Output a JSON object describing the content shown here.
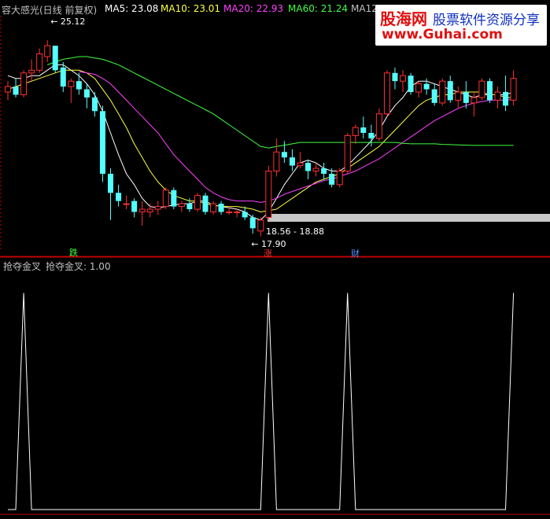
{
  "header": {
    "indicator_name": "容大感光(日线 前复权)",
    "ma5": "MA5: 23.08",
    "ma10": "MA10: 23.01",
    "ma20": "MA20: 22.93",
    "ma60": "MA60: 21.24",
    "ma120": "MA12"
  },
  "lower_panel": {
    "title": "抢夺金叉",
    "value": "抢夺金叉: 1.00"
  },
  "watermark": {
    "brand": "股海网",
    "slogan": "股票软件资源分享",
    "url": "www.Guhai.com"
  },
  "colors": {
    "up": "#ff3030",
    "down": "#54ffff",
    "ma5": "#ffffff",
    "ma10": "#ffff40",
    "ma20": "#ff40ff",
    "ma60": "#40ff40",
    "ma120": "#c0c0c0",
    "grid": "#8b0000"
  },
  "chart_data": [
    {
      "type": "candlestick",
      "annotations": {
        "high_label": "25.12",
        "low_label": "17.90",
        "range_label": "18.56 - 18.88",
        "marker_down": "跌",
        "marker_up": "涨",
        "marker_wealth": "财"
      },
      "ylim": [
        17.4,
        26.0
      ],
      "candles": [
        [
          23.2,
          23.6,
          22.9,
          23.4
        ],
        [
          23.4,
          23.7,
          23.0,
          23.1
        ],
        [
          23.1,
          24.0,
          23.0,
          23.9
        ],
        [
          23.9,
          24.4,
          23.6,
          24.0
        ],
        [
          24.0,
          24.8,
          23.9,
          24.6
        ],
        [
          24.5,
          25.1,
          24.3,
          24.9
        ],
        [
          24.9,
          24.9,
          23.9,
          24.0
        ],
        [
          24.1,
          24.3,
          23.2,
          23.4
        ],
        [
          23.4,
          23.7,
          22.8,
          23.6
        ],
        [
          23.6,
          23.9,
          23.1,
          23.3
        ],
        [
          23.3,
          23.5,
          22.6,
          23.0
        ],
        [
          23.0,
          23.2,
          22.3,
          22.5
        ],
        [
          22.5,
          22.7,
          19.9,
          20.2
        ],
        [
          20.2,
          20.4,
          18.5,
          19.5
        ],
        [
          19.5,
          19.8,
          19.0,
          19.2
        ],
        [
          19.1,
          19.4,
          18.9,
          19.1
        ],
        [
          19.2,
          19.3,
          18.6,
          18.8
        ],
        [
          18.8,
          19.2,
          18.3,
          18.9
        ],
        [
          18.8,
          19.1,
          18.6,
          18.9
        ],
        [
          18.9,
          19.2,
          18.7,
          19.0
        ],
        [
          19.0,
          19.7,
          18.9,
          19.6
        ],
        [
          19.6,
          19.7,
          18.9,
          19.0
        ],
        [
          19.0,
          19.2,
          18.8,
          19.1
        ],
        [
          19.1,
          19.3,
          18.8,
          18.9
        ],
        [
          18.9,
          19.5,
          18.8,
          19.4
        ],
        [
          19.4,
          19.5,
          18.7,
          18.8
        ],
        [
          18.8,
          19.2,
          18.7,
          19.1
        ],
        [
          19.1,
          19.2,
          18.7,
          18.8
        ],
        [
          18.8,
          19.0,
          18.7,
          18.8
        ],
        [
          18.8,
          18.9,
          18.6,
          18.8
        ],
        [
          18.8,
          19.0,
          18.5,
          18.6
        ],
        [
          18.6,
          18.7,
          18.0,
          18.2
        ],
        [
          18.1,
          18.6,
          17.9,
          18.5
        ],
        [
          18.6,
          20.5,
          18.5,
          20.3
        ],
        [
          20.3,
          21.5,
          20.1,
          21.0
        ],
        [
          21.0,
          21.4,
          20.6,
          20.8
        ],
        [
          20.8,
          21.1,
          20.3,
          20.5
        ],
        [
          20.5,
          21.0,
          20.4,
          20.6
        ],
        [
          20.6,
          20.7,
          20.0,
          20.3
        ],
        [
          20.3,
          20.6,
          20.1,
          20.4
        ],
        [
          20.4,
          20.6,
          20.0,
          20.2
        ],
        [
          20.2,
          20.4,
          19.7,
          19.8
        ],
        [
          19.8,
          20.4,
          19.7,
          20.3
        ],
        [
          20.3,
          21.7,
          20.2,
          21.6
        ],
        [
          21.6,
          22.0,
          21.3,
          21.9
        ],
        [
          21.9,
          22.3,
          21.5,
          21.7
        ],
        [
          21.7,
          22.0,
          21.2,
          21.5
        ],
        [
          21.5,
          22.6,
          21.4,
          22.4
        ],
        [
          22.4,
          24.0,
          22.3,
          23.9
        ],
        [
          23.9,
          24.1,
          23.3,
          23.6
        ],
        [
          23.6,
          24.0,
          23.2,
          23.8
        ],
        [
          23.8,
          23.9,
          23.1,
          23.2
        ],
        [
          23.2,
          23.6,
          23.0,
          23.5
        ],
        [
          23.5,
          23.7,
          23.1,
          23.3
        ],
        [
          23.3,
          23.5,
          22.7,
          22.8
        ],
        [
          22.8,
          23.7,
          22.7,
          23.6
        ],
        [
          23.6,
          23.8,
          22.8,
          22.9
        ],
        [
          22.9,
          23.4,
          22.6,
          23.2
        ],
        [
          23.2,
          23.6,
          22.6,
          22.8
        ],
        [
          22.8,
          23.2,
          22.3,
          23.0
        ],
        [
          23.0,
          23.7,
          22.9,
          23.6
        ],
        [
          23.6,
          23.7,
          22.8,
          22.9
        ],
        [
          22.9,
          23.4,
          22.6,
          23.2
        ],
        [
          23.2,
          23.8,
          22.5,
          22.7
        ],
        [
          22.9,
          24.0,
          22.7,
          23.7
        ]
      ],
      "ma_series": [
        {
          "name": "MA5",
          "values": [
            23.8,
            23.7,
            23.7,
            23.8,
            23.8,
            24.0,
            24.2,
            24.2,
            24.0,
            23.8,
            23.5,
            23.1,
            22.5,
            21.7,
            20.9,
            20.2,
            19.8,
            19.3,
            19.0,
            18.95,
            19.0,
            19.05,
            19.1,
            19.1,
            19.2,
            19.2,
            19.05,
            19.0,
            18.95,
            18.9,
            18.8,
            18.6,
            18.5,
            18.8,
            19.3,
            19.8,
            20.2,
            20.6,
            20.7,
            20.6,
            20.4,
            20.3,
            20.3,
            20.5,
            20.8,
            21.1,
            21.4,
            21.8,
            22.3,
            22.7,
            23.0,
            23.4,
            23.6,
            23.6,
            23.5,
            23.4,
            23.3,
            23.2,
            23.1,
            23.0,
            23.1,
            23.1,
            23.1,
            23.1,
            23.2
          ]
        },
        {
          "name": "MA10",
          "values": [
            23.3,
            23.4,
            23.5,
            23.6,
            23.7,
            23.8,
            23.9,
            24.0,
            24.0,
            24.0,
            23.9,
            23.7,
            23.3,
            22.9,
            22.4,
            21.9,
            21.3,
            20.8,
            20.3,
            19.9,
            19.6,
            19.4,
            19.3,
            19.2,
            19.2,
            19.1,
            19.05,
            19.0,
            19.0,
            19.0,
            18.95,
            18.9,
            18.8,
            18.85,
            18.9,
            19.1,
            19.3,
            19.5,
            19.7,
            19.9,
            20.0,
            20.1,
            20.2,
            20.4,
            20.6,
            20.8,
            21.0,
            21.2,
            21.5,
            21.8,
            22.1,
            22.4,
            22.7,
            22.9,
            23.0,
            23.1,
            23.1,
            23.2,
            23.2,
            23.2,
            23.2,
            23.1,
            23.1,
            23.0,
            23.0
          ]
        },
        {
          "name": "MA20",
          "values": [
            null,
            null,
            null,
            null,
            null,
            null,
            null,
            null,
            null,
            23.95,
            23.9,
            23.85,
            23.7,
            23.5,
            23.2,
            22.9,
            22.6,
            22.3,
            22.0,
            21.7,
            21.3,
            20.9,
            20.6,
            20.3,
            20.0,
            19.7,
            19.5,
            19.35,
            19.25,
            19.2,
            19.2,
            19.2,
            19.15,
            19.2,
            19.3,
            19.45,
            19.55,
            19.65,
            19.75,
            19.85,
            19.95,
            20.0,
            20.1,
            20.2,
            20.3,
            20.45,
            20.6,
            20.75,
            20.95,
            21.15,
            21.35,
            21.55,
            21.75,
            21.95,
            22.15,
            22.3,
            22.45,
            22.6,
            22.7,
            22.8,
            22.85,
            22.9,
            22.9,
            22.9,
            22.93
          ]
        },
        {
          "name": "MA60",
          "values": [
            null,
            null,
            null,
            null,
            null,
            24.2,
            24.3,
            24.4,
            24.45,
            24.5,
            24.5,
            24.45,
            24.4,
            24.3,
            24.2,
            24.05,
            23.9,
            23.75,
            23.6,
            23.45,
            23.3,
            23.15,
            23.0,
            22.85,
            22.7,
            22.55,
            22.4,
            22.2,
            22.0,
            21.8,
            21.6,
            21.4,
            21.2,
            21.15,
            21.2,
            21.25,
            21.3,
            21.35,
            21.35,
            21.35,
            21.35,
            21.35,
            21.35,
            21.35,
            21.35,
            21.35,
            21.35,
            21.35,
            21.35,
            21.35,
            21.32,
            21.3,
            21.3,
            21.3,
            21.3,
            21.28,
            21.27,
            21.26,
            21.25,
            21.24,
            21.24,
            21.24,
            21.24,
            21.24,
            21.24
          ]
        },
        {
          "name": "MA120",
          "values": [
            null,
            null,
            null,
            null,
            null,
            null,
            null,
            null,
            null,
            null,
            null,
            null,
            null,
            null,
            null,
            null,
            null,
            null,
            null,
            null,
            null,
            null,
            null,
            null,
            null,
            null,
            null,
            null,
            null,
            null,
            null,
            null,
            null,
            null,
            null,
            null,
            null,
            null,
            null,
            null,
            null,
            null,
            null,
            null,
            null,
            null,
            null,
            null,
            null,
            null,
            null,
            null,
            null,
            null,
            null,
            null,
            null,
            null,
            null,
            null,
            null,
            null,
            null,
            null,
            null
          ]
        }
      ]
    },
    {
      "type": "line",
      "series": [
        {
          "name": "抢夺金叉",
          "values": [
            0,
            0,
            1,
            0,
            0,
            0,
            0,
            0,
            0,
            0,
            0,
            0,
            0,
            0,
            0,
            0,
            0,
            0,
            0,
            0,
            0,
            0,
            0,
            0,
            0,
            0,
            0,
            0,
            0,
            0,
            0,
            0,
            0,
            1,
            0,
            0,
            0,
            0,
            0,
            0,
            0,
            0,
            0,
            1,
            0,
            0,
            0,
            0,
            0,
            0,
            0,
            0,
            0,
            0,
            0,
            0,
            0,
            0,
            0,
            0,
            0,
            0,
            0,
            0,
            1
          ]
        }
      ],
      "ylim": [
        0,
        1.1
      ]
    }
  ]
}
